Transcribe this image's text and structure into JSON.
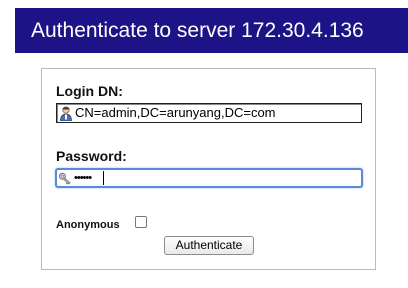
{
  "header": {
    "title": "Authenticate to server 172.30.4.136"
  },
  "form": {
    "login_dn_label": "Login DN:",
    "login_dn_value": "CN=admin,DC=arunyang,DC=com",
    "login_dn_icon": "user-icon",
    "password_label": "Password:",
    "password_value": "••••••",
    "password_icon": "key-icon",
    "anonymous_label": "Anonymous",
    "anonymous_checked": false,
    "submit_label": "Authenticate"
  },
  "colors": {
    "header_bg": "#1c1386",
    "focus_border": "#5b8ad6"
  }
}
